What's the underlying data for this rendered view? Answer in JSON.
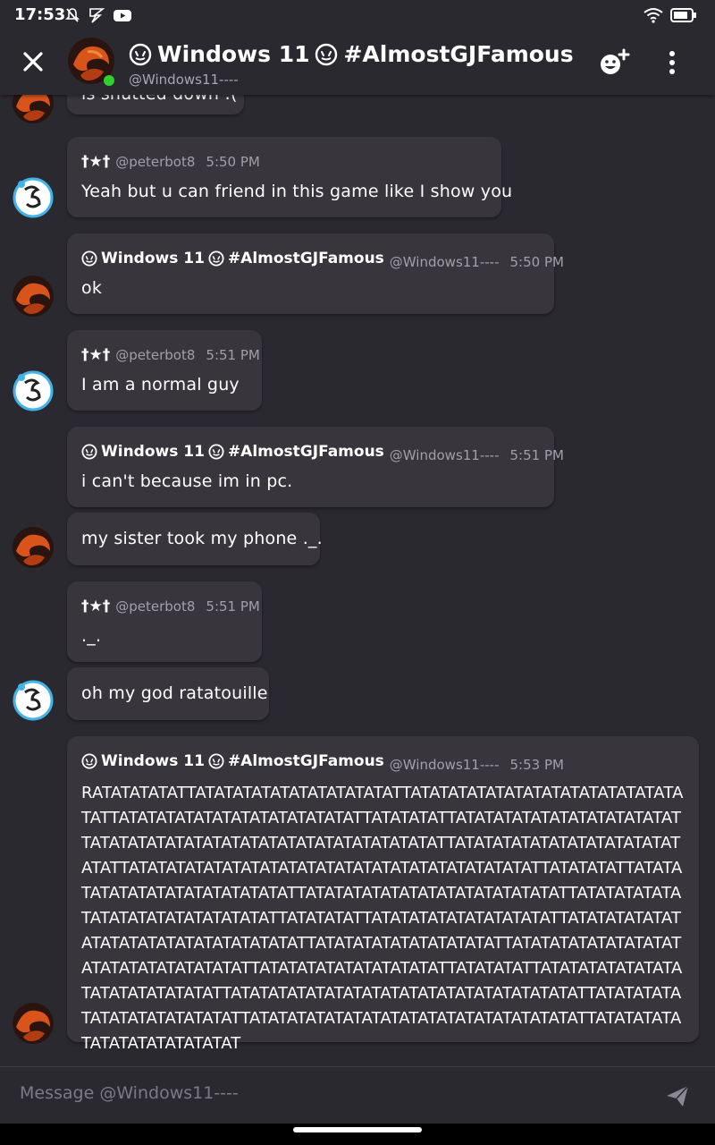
{
  "status": {
    "time": "17:53"
  },
  "header": {
    "title_text": "Windows 11",
    "title_tag": "#AlmostGJFamous",
    "subtitle": "@Windows11----"
  },
  "messages": [
    {
      "text": "is shutted down :("
    },
    {
      "name": "†★†",
      "handle": "@peterbot8",
      "time": "5:50 PM",
      "text": "Yeah but u can friend in this game like I show you"
    },
    {
      "name_a": "Windows 11",
      "name_b": "#AlmostGJFamous",
      "handle": "@Windows11----",
      "time": "5:50 PM",
      "text": "ok"
    },
    {
      "name": "†★†",
      "handle": "@peterbot8",
      "time": "5:51 PM",
      "text": "I am a normal guy"
    },
    {
      "name_a": "Windows 11",
      "name_b": "#AlmostGJFamous",
      "handle": "@Windows11----",
      "time": "5:51 PM",
      "text": "i can't because im in pc."
    },
    {
      "text": "my sister took my phone ._."
    },
    {
      "name": "†★†",
      "handle": "@peterbot8",
      "time": "5:51 PM",
      "text": "._."
    },
    {
      "text": "oh my god ratatouille"
    },
    {
      "name_a": "Windows 11",
      "name_b": "#AlmostGJFamous",
      "handle": "@Windows11----",
      "time": "5:53 PM",
      "text": "RATATATATATTATATATATATATATATATATATTATATATATATATATATATATATATATATATATTATATATATATATATATATATATATATTATATATATTATATATATATATATATATATATATTATATATATATATATATATATATATATATATATATATATTATATATATATATATATATATATATATATTATATATATATATATATATATATATATATATATATATATATATATTATATATATTATATATATATATATATATATATATATATTATATATATATATATATATATATATATATTATATATATATATATATATATATATATATATATTATATATATTATATATATATATATATATATTATATATATATATATATATATATATATATATATATATTATATATATATATATATATATTATATATATATATATATATATATATATATATATATATTATATATATATATATATATATTATATATATTATATATATATATATATATATATATATATATTATATATATATATATATATATATATATATATATATATATTATATATATATATATATATATATATATTATATATATATATATATATATATATATATATATATATTATATATATATATATATATATATATAT"
    }
  ],
  "composer": {
    "placeholder": "Message @Windows11----"
  }
}
